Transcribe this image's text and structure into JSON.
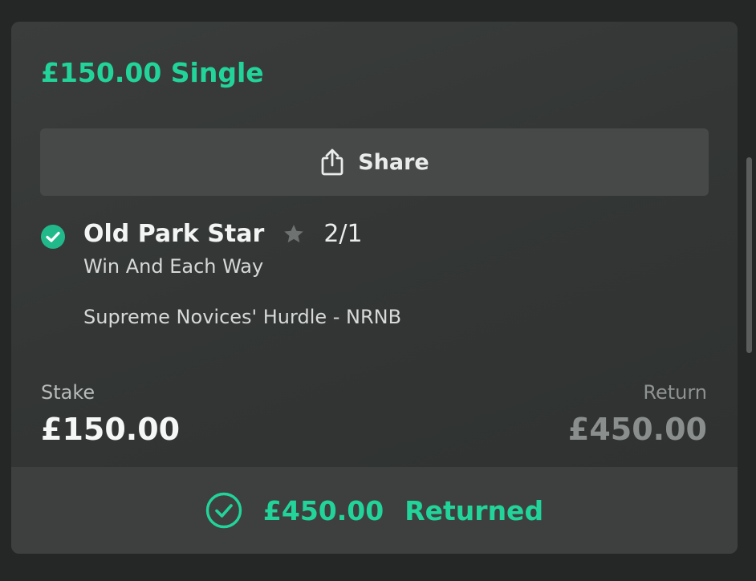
{
  "bet": {
    "title": "£150.00 Single",
    "share_label": "Share",
    "selection_name": "Old Park Star",
    "odds": "2/1",
    "bet_type": "Win And Each Way",
    "market": "Supreme Novices' Hurdle - NRNB",
    "stake_label": "Stake",
    "stake_value": "£150.00",
    "return_label": "Return",
    "return_value": "£450.00",
    "footer_amount": "£450.00",
    "footer_status": "Returned"
  },
  "icons": {
    "share": "share-icon",
    "selection_status": "check-circle-icon",
    "favourite": "star-icon",
    "returned_status": "check-circle-outline-icon"
  },
  "colors": {
    "accent": "#22d49a",
    "card_background": "#343736",
    "page_background": "#252726",
    "muted_text": "#8a8e8c"
  }
}
